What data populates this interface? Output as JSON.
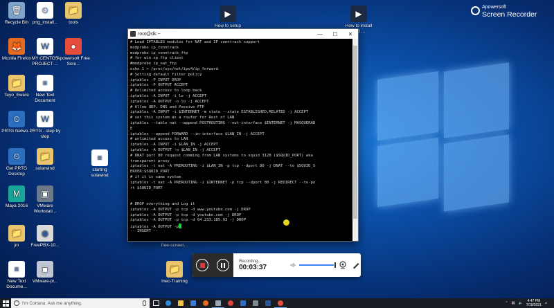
{
  "desktop_icons": [
    {
      "label": "Recycle Bin",
      "glyph": "🗑",
      "bg": "#7fa4c9"
    },
    {
      "label": "prtg_install...",
      "glyph": "⏲",
      "bg": "#ffffff"
    },
    {
      "label": "tools",
      "glyph": "📁",
      "bg": "#e9c46a"
    },
    {
      "label": "How to setup and config...",
      "glyph": "▶",
      "bg": "#1d2a44"
    },
    {
      "label": "How to install and ...",
      "glyph": "▶",
      "bg": "#1d2a44"
    },
    {
      "label": "Mozilla Firefox",
      "glyph": "🦊",
      "bg": "#e66a1f"
    },
    {
      "label": "MY CENTOS PROJECT ...",
      "glyph": "W",
      "bg": "#ffffff"
    },
    {
      "label": "Apowersoft Free Scre...",
      "glyph": "●",
      "bg": "#e74c3c"
    },
    {
      "label": "Teyo_Ewere",
      "glyph": "📁",
      "bg": "#e9c46a"
    },
    {
      "label": "New Text Document",
      "glyph": "≡",
      "bg": "#ffffff"
    },
    {
      "label": "PRTG Netwo...",
      "glyph": "⏲",
      "bg": "#2c6fbf"
    },
    {
      "label": "PRTG - step by step",
      "glyph": "W",
      "bg": "#ffffff"
    },
    {
      "label": "Get PRTG Desktop",
      "glyph": "⏲",
      "bg": "#2c6fbf"
    },
    {
      "label": "solarwind",
      "glyph": "📁",
      "bg": "#e9c46a"
    },
    {
      "label": "starting solawind",
      "glyph": "≡",
      "bg": "#ffffff"
    },
    {
      "label": "Maya 2016",
      "glyph": "M",
      "bg": "#1aa59a"
    },
    {
      "label": "VMware Workstati...",
      "glyph": "▣",
      "bg": "#6c7a89"
    },
    {
      "label": "jm",
      "glyph": "📁",
      "bg": "#e9c46a"
    },
    {
      "label": "FreePBX-10...",
      "glyph": "◉",
      "bg": "#d9d9d9"
    },
    {
      "label": "free-screen...",
      "glyph": "📁",
      "bg": "#e9c46a"
    },
    {
      "label": "New Text Docume...",
      "glyph": "≡",
      "bg": "#ffffff"
    },
    {
      "label": "VMware-pl...",
      "glyph": "▣",
      "bg": "#c0c8d6"
    },
    {
      "label": "Inec-Training",
      "glyph": "📁",
      "bg": "#e9c46a"
    }
  ],
  "recorder_brand": {
    "line1": "Apowersoft",
    "line2": "Screen Recorder"
  },
  "terminal": {
    "title": "root@dk:~",
    "lines": [
      "# Load IPTABLES modules for NAT and IP conntrack support",
      "modprobe ip_conntrack",
      "modprobe ip_conntrack_ftp",
      "# for win xp ftp client",
      "#modprobe ip_nat_ftp",
      "echo 1 > /proc/sys/net/ipv4/ip_forward",
      "# Setting default filter policy",
      "iptables -P INPUT DROP",
      "iptables -P OUTPUT ACCEPT",
      "# Unlimited access to loop back",
      "iptables -A INPUT -i lo -j ACCEPT",
      "iptables -A OUTPUT -o lo -j ACCEPT",
      "# Allow UDP, DNS and Passive FTP",
      "iptables -A INPUT -i $INTERNET -m state --state ESTABLISHED,RELATED -j ACCEPT",
      "# set this system as a router for Rest of LAN",
      "iptables --table nat --append POSTROUTING --out-interface $INTERNET -j MASQUERAD",
      "E",
      "iptables --append FORWARD --in-interface $LAN_IN -j ACCEPT",
      "# unlimited access to LAN",
      "iptables -A INPUT -i $LAN_IN -j ACCEPT",
      "iptables -A OUTPUT -o $LAN_IN -j ACCEPT",
      "# DNAT port 80 request comming from LAN systems to squid 3128 ($SQUID_PORT) aka",
      "transparent proxy",
      "iptables -t nat -A PREROUTING -i $LAN_IN -p tcp --dport 80 -j DNAT --to $SQUID_S",
      "ERVER:$SQUID_PORT",
      "# if it is same system",
      "iptables -t nat -A PREROUTING -i $INTERNET -p tcp --dport 80 -j REDIRECT --to-po",
      "rt $SQUID_PORT",
      "",
      "",
      "# DROP everything and Log it",
      "iptables -A OUTPUT -p tcp -d www.youtube.com -j DROP",
      "iptables -A OUTPUT -p tcp -d youtube.com -j DROP",
      "iptables -A OUTPUT -p tcp -d 64.233.185.93 -j DROP",
      "iptables -A OUTPUT -p"
    ],
    "status_line": "-- INSERT --"
  },
  "recording": {
    "status": "Recording...",
    "time": "00:03:37"
  },
  "taskbar": {
    "search_placeholder": "I'm Cortana. Ask me anything.",
    "time": "4:47 PM",
    "date": "7/19/2021"
  },
  "colors": {
    "accent": "#1a78d6",
    "stop_red": "#e8323c",
    "cursor_green": "#19d43a",
    "highlight_yellow": "#f3e21c"
  }
}
